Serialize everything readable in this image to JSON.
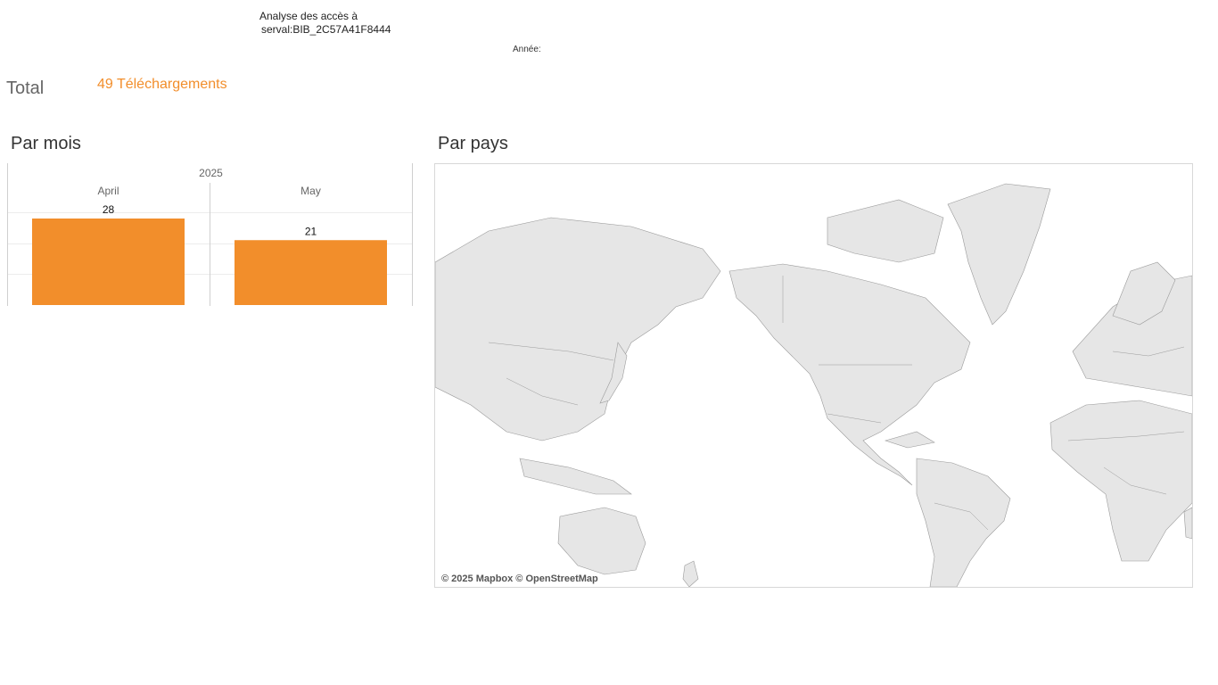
{
  "header": {
    "title_line1": "Analyse des accès à",
    "title_line2": "serval:BIB_2C57A41F8444",
    "year_filter_label": "Année:"
  },
  "total": {
    "label": "Total",
    "value": "49 Téléchargements"
  },
  "sections": {
    "par_mois": "Par mois",
    "par_pays": "Par pays"
  },
  "chart_data": {
    "type": "bar",
    "title": "Par mois",
    "group_label": "2025",
    "categories": [
      "April",
      "May"
    ],
    "values": [
      28,
      21
    ],
    "ylim": [
      0,
      28
    ],
    "grid": true,
    "color": "#f28e2b"
  },
  "map": {
    "attribution": "© 2025 Mapbox © OpenStreetMap",
    "land_color": "#e6e6e6",
    "border_color": "#8a8a8a"
  }
}
